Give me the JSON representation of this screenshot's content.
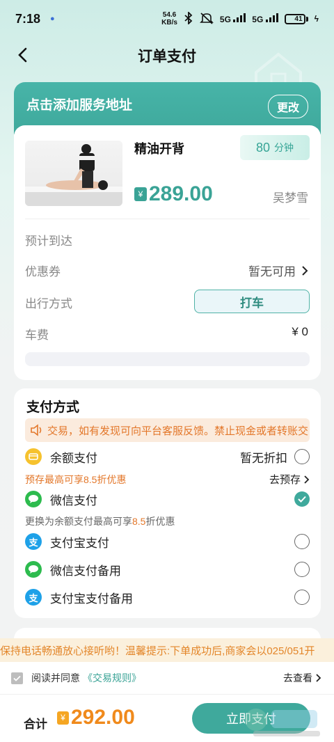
{
  "status_bar": {
    "time": "7:18",
    "speed_value": "54.6",
    "speed_unit": "KB/s",
    "net1": "5G",
    "net2": "5G",
    "battery": "41",
    "battery_level": 0.41
  },
  "nav": {
    "title": "订单支付"
  },
  "address": {
    "prompt": "点击添加服务地址",
    "change": "更改"
  },
  "service": {
    "name": "精油开背",
    "duration_value": "80",
    "duration_unit": "分钟",
    "currency": "¥",
    "price": "289.00",
    "therapist": "吴梦雪"
  },
  "details": {
    "arrival_label": "预计到达",
    "coupon_label": "优惠券",
    "coupon_value": "暂无可用",
    "travel_label": "出行方式",
    "travel_value": "打车",
    "fare_label": "车费",
    "fare_value": "¥ 0"
  },
  "payment": {
    "title": "支付方式",
    "notice": "交易，如有发现可向平台客服反馈。禁止现金或者转账交",
    "balance_label": "余额支付",
    "balance_right": "暂无折扣",
    "prestore_tip": "预存最高可享8.5折优惠",
    "prestore_link": "去预存",
    "wechat_label": "微信支付",
    "switch_tip_prefix": "更换为余额支付最高可享",
    "switch_tip_highlight": "8.5",
    "switch_tip_suffix": "折优惠",
    "alipay_label": "支付宝支付",
    "wechat_backup_label": "微信支付备用",
    "alipay_backup_label": "支付宝支付备用"
  },
  "marquee": "保持电话畅通放心接听哟！温馨提示:下单成功后,商家会以025/051开",
  "agreement": {
    "text": "阅读并同意",
    "rule": "《交易规则》",
    "view": "去查看"
  },
  "footer": {
    "total_label": "合计",
    "currency": "¥",
    "total": "292.00",
    "pay_button": "立即支付"
  },
  "colors": {
    "accent": "#3fa99c",
    "orange": "#e3772a",
    "price_orange": "#f08a1c"
  }
}
